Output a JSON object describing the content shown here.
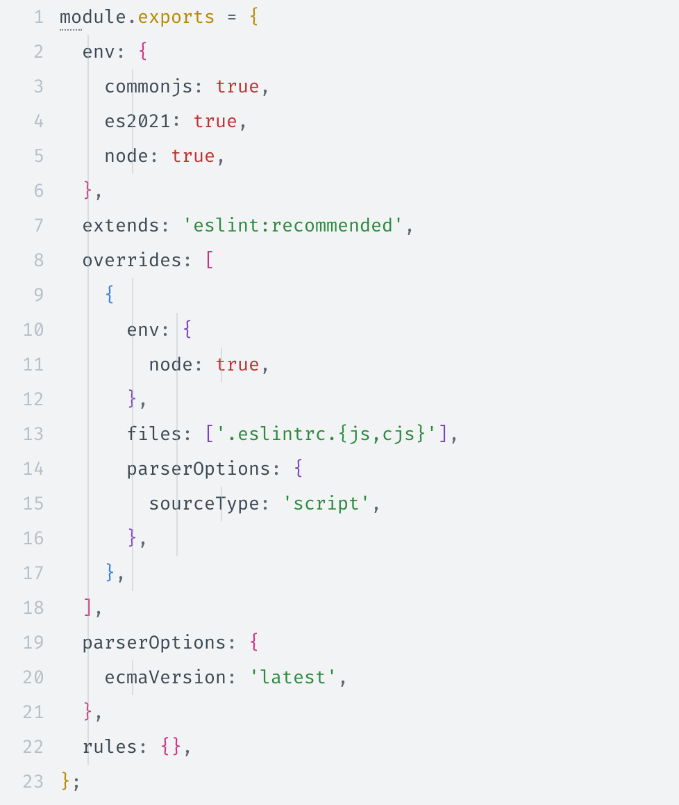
{
  "lines": [
    {
      "num": "1",
      "indent": 0,
      "guides": [],
      "tokens": [
        {
          "cls": "tok-default dotted",
          "t": "mo"
        },
        {
          "cls": "tok-default",
          "t": "dule"
        },
        {
          "cls": "tok-punct",
          "t": "."
        },
        {
          "cls": "tok-export",
          "t": "exports"
        },
        {
          "cls": "tok-default",
          "t": " "
        },
        {
          "cls": "tok-punct",
          "t": "="
        },
        {
          "cls": "tok-default",
          "t": " "
        },
        {
          "cls": "tok-brace-yl",
          "t": "{"
        }
      ]
    },
    {
      "num": "2",
      "indent": 1,
      "guides": [
        0
      ],
      "tokens": [
        {
          "cls": "tok-prop",
          "t": "env"
        },
        {
          "cls": "tok-punct",
          "t": ":"
        },
        {
          "cls": "tok-default",
          "t": " "
        },
        {
          "cls": "tok-brace-mg",
          "t": "{"
        }
      ]
    },
    {
      "num": "3",
      "indent": 2,
      "guides": [
        0,
        1
      ],
      "tokens": [
        {
          "cls": "tok-prop",
          "t": "commonjs"
        },
        {
          "cls": "tok-punct",
          "t": ":"
        },
        {
          "cls": "tok-default",
          "t": " "
        },
        {
          "cls": "tok-bool",
          "t": "true"
        },
        {
          "cls": "tok-punct",
          "t": ","
        }
      ]
    },
    {
      "num": "4",
      "indent": 2,
      "guides": [
        0,
        1
      ],
      "tokens": [
        {
          "cls": "tok-prop",
          "t": "es2021"
        },
        {
          "cls": "tok-punct",
          "t": ":"
        },
        {
          "cls": "tok-default",
          "t": " "
        },
        {
          "cls": "tok-bool",
          "t": "true"
        },
        {
          "cls": "tok-punct",
          "t": ","
        }
      ]
    },
    {
      "num": "5",
      "indent": 2,
      "guides": [
        0,
        1
      ],
      "tokens": [
        {
          "cls": "tok-prop",
          "t": "node"
        },
        {
          "cls": "tok-punct",
          "t": ":"
        },
        {
          "cls": "tok-default",
          "t": " "
        },
        {
          "cls": "tok-bool",
          "t": "true"
        },
        {
          "cls": "tok-punct",
          "t": ","
        }
      ]
    },
    {
      "num": "6",
      "indent": 1,
      "guides": [
        0
      ],
      "tokens": [
        {
          "cls": "tok-brace-mg",
          "t": "}"
        },
        {
          "cls": "tok-punct",
          "t": ","
        }
      ]
    },
    {
      "num": "7",
      "indent": 1,
      "guides": [
        0
      ],
      "tokens": [
        {
          "cls": "tok-prop",
          "t": "extends"
        },
        {
          "cls": "tok-punct",
          "t": ":"
        },
        {
          "cls": "tok-default",
          "t": " "
        },
        {
          "cls": "tok-string",
          "t": "'eslint:recommended'"
        },
        {
          "cls": "tok-punct",
          "t": ","
        }
      ]
    },
    {
      "num": "8",
      "indent": 1,
      "guides": [
        0
      ],
      "tokens": [
        {
          "cls": "tok-prop",
          "t": "overrides"
        },
        {
          "cls": "tok-punct",
          "t": ":"
        },
        {
          "cls": "tok-default",
          "t": " "
        },
        {
          "cls": "tok-brace-mg",
          "t": "["
        }
      ]
    },
    {
      "num": "9",
      "indent": 2,
      "guides": [
        0,
        1
      ],
      "tokens": [
        {
          "cls": "tok-brace-bl",
          "t": "{"
        }
      ]
    },
    {
      "num": "10",
      "indent": 3,
      "guides": [
        0,
        1,
        2
      ],
      "tokens": [
        {
          "cls": "tok-prop",
          "t": "env"
        },
        {
          "cls": "tok-punct",
          "t": ":"
        },
        {
          "cls": "tok-default",
          "t": " "
        },
        {
          "cls": "tok-brace-pu",
          "t": "{"
        }
      ]
    },
    {
      "num": "11",
      "indent": 4,
      "guides": [
        0,
        1,
        2,
        3
      ],
      "tokens": [
        {
          "cls": "tok-prop",
          "t": "node"
        },
        {
          "cls": "tok-punct",
          "t": ":"
        },
        {
          "cls": "tok-default",
          "t": " "
        },
        {
          "cls": "tok-bool",
          "t": "true"
        },
        {
          "cls": "tok-punct",
          "t": ","
        }
      ]
    },
    {
      "num": "12",
      "indent": 3,
      "guides": [
        0,
        1,
        2
      ],
      "tokens": [
        {
          "cls": "tok-brace-pu",
          "t": "}"
        },
        {
          "cls": "tok-punct",
          "t": ","
        }
      ]
    },
    {
      "num": "13",
      "indent": 3,
      "guides": [
        0,
        1,
        2
      ],
      "tokens": [
        {
          "cls": "tok-prop",
          "t": "files"
        },
        {
          "cls": "tok-punct",
          "t": ":"
        },
        {
          "cls": "tok-default",
          "t": " "
        },
        {
          "cls": "tok-brace-pu",
          "t": "["
        },
        {
          "cls": "tok-string",
          "t": "'.eslintrc.{js,cjs}'"
        },
        {
          "cls": "tok-brace-pu",
          "t": "]"
        },
        {
          "cls": "tok-punct",
          "t": ","
        }
      ]
    },
    {
      "num": "14",
      "indent": 3,
      "guides": [
        0,
        1,
        2
      ],
      "tokens": [
        {
          "cls": "tok-prop",
          "t": "parserOptions"
        },
        {
          "cls": "tok-punct",
          "t": ":"
        },
        {
          "cls": "tok-default",
          "t": " "
        },
        {
          "cls": "tok-brace-pu",
          "t": "{"
        }
      ]
    },
    {
      "num": "15",
      "indent": 4,
      "guides": [
        0,
        1,
        2,
        3
      ],
      "tokens": [
        {
          "cls": "tok-prop",
          "t": "sourceType"
        },
        {
          "cls": "tok-punct",
          "t": ":"
        },
        {
          "cls": "tok-default",
          "t": " "
        },
        {
          "cls": "tok-string",
          "t": "'script'"
        },
        {
          "cls": "tok-punct",
          "t": ","
        }
      ]
    },
    {
      "num": "16",
      "indent": 3,
      "guides": [
        0,
        1,
        2
      ],
      "tokens": [
        {
          "cls": "tok-brace-pu",
          "t": "}"
        },
        {
          "cls": "tok-punct",
          "t": ","
        }
      ]
    },
    {
      "num": "17",
      "indent": 2,
      "guides": [
        0,
        1
      ],
      "tokens": [
        {
          "cls": "tok-brace-bl",
          "t": "}"
        },
        {
          "cls": "tok-punct",
          "t": ","
        }
      ]
    },
    {
      "num": "18",
      "indent": 1,
      "guides": [
        0
      ],
      "tokens": [
        {
          "cls": "tok-brace-mg",
          "t": "]"
        },
        {
          "cls": "tok-punct",
          "t": ","
        }
      ]
    },
    {
      "num": "19",
      "indent": 1,
      "guides": [
        0
      ],
      "tokens": [
        {
          "cls": "tok-prop",
          "t": "parserOptions"
        },
        {
          "cls": "tok-punct",
          "t": ":"
        },
        {
          "cls": "tok-default",
          "t": " "
        },
        {
          "cls": "tok-brace-mg",
          "t": "{"
        }
      ]
    },
    {
      "num": "20",
      "indent": 2,
      "guides": [
        0,
        1
      ],
      "tokens": [
        {
          "cls": "tok-prop",
          "t": "ecmaVersion"
        },
        {
          "cls": "tok-punct",
          "t": ":"
        },
        {
          "cls": "tok-default",
          "t": " "
        },
        {
          "cls": "tok-string",
          "t": "'latest'"
        },
        {
          "cls": "tok-punct",
          "t": ","
        }
      ]
    },
    {
      "num": "21",
      "indent": 1,
      "guides": [
        0
      ],
      "tokens": [
        {
          "cls": "tok-brace-mg",
          "t": "}"
        },
        {
          "cls": "tok-punct",
          "t": ","
        }
      ]
    },
    {
      "num": "22",
      "indent": 1,
      "guides": [
        0
      ],
      "tokens": [
        {
          "cls": "tok-prop",
          "t": "rules"
        },
        {
          "cls": "tok-punct",
          "t": ":"
        },
        {
          "cls": "tok-default",
          "t": " "
        },
        {
          "cls": "tok-brace-mg",
          "t": "{"
        },
        {
          "cls": "tok-brace-mg",
          "t": "}"
        },
        {
          "cls": "tok-punct",
          "t": ","
        }
      ]
    },
    {
      "num": "23",
      "indent": 0,
      "guides": [],
      "tokens": [
        {
          "cls": "tok-brace-yl",
          "t": "}"
        },
        {
          "cls": "tok-punct",
          "t": ";"
        }
      ]
    }
  ],
  "indentUnitPx": 32,
  "guideStartPx": 40
}
